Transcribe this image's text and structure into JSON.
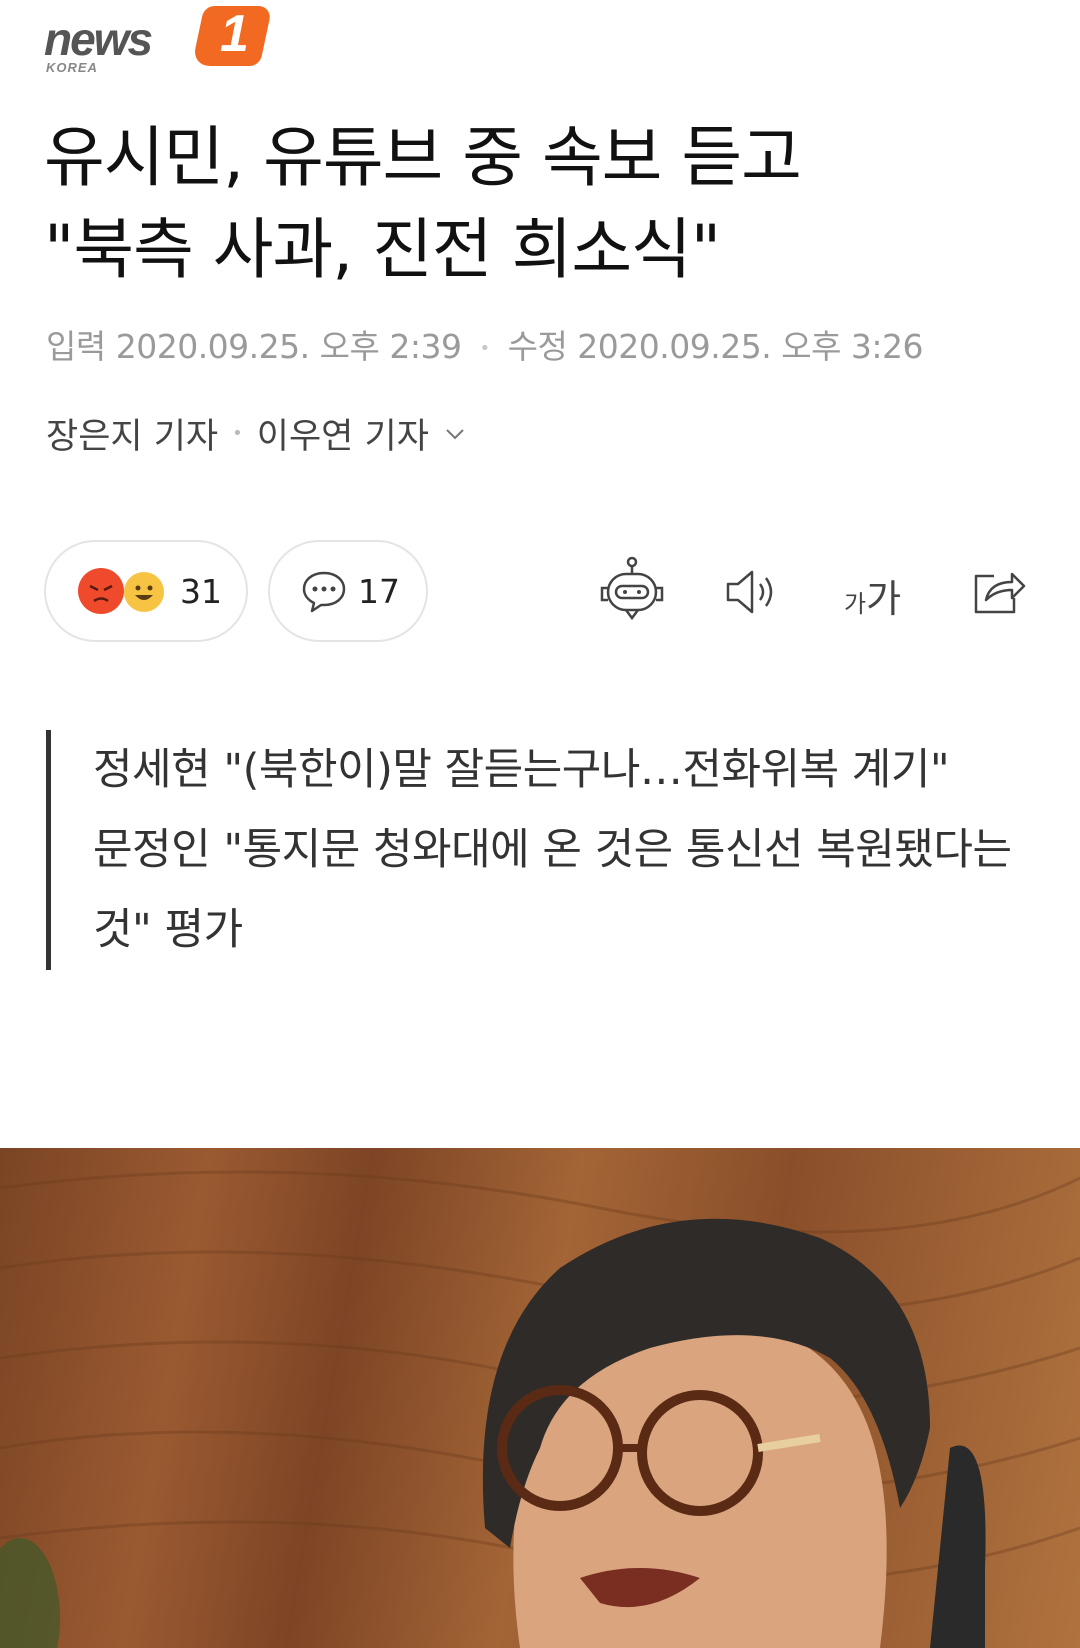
{
  "brand": {
    "name": "news",
    "number": "1",
    "region": "KOREA"
  },
  "headline": [
    "유시민, 유튜브 중 속보 듣고",
    "\"북측 사과, 진전 희소식\""
  ],
  "meta": {
    "published": "입력 2020.09.25. 오후 2:39",
    "modified": "수정 2020.09.25. 오후 3:26"
  },
  "reporters": [
    "장은지 기자",
    "이우연 기자"
  ],
  "reactions": {
    "count": "31"
  },
  "comments": {
    "count": "17"
  },
  "toolbar": {
    "font_size_label": "가가"
  },
  "summary": [
    "정세현 \"(북한이)말 잘듣는구나…전화위복 계기\"",
    "문정인 \"통지문 청와대에 온 것은 통신선 복원됐다는 것\" 평가"
  ],
  "colors": {
    "brand_orange": "#f26a22",
    "meta_gray": "#9a9a9a",
    "angry_red": "#ef4a2c",
    "happy_yellow": "#f6c343"
  },
  "icons": [
    "angry-emoji-icon",
    "happy-emoji-icon",
    "comment-bubble-icon",
    "robot-icon",
    "speaker-icon",
    "font-size-icon",
    "share-icon",
    "chevron-down-icon"
  ]
}
